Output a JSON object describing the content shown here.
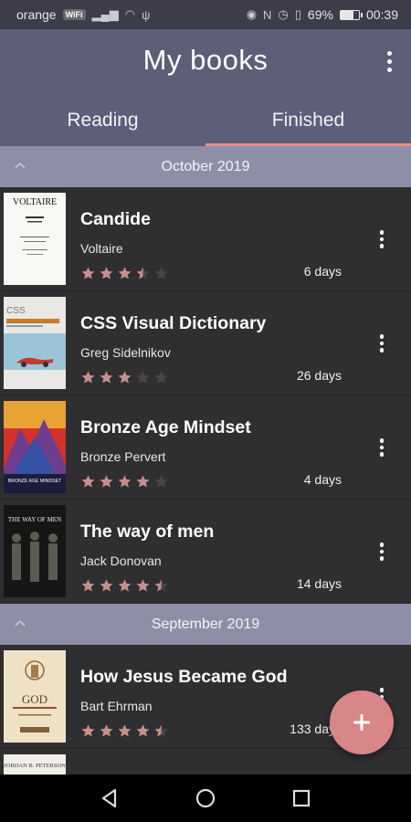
{
  "status_bar": {
    "carrier": "orange",
    "carrier_badge": "WiFi",
    "battery": "69%",
    "battery_level": 0.69,
    "time": "00:39"
  },
  "header": {
    "title": "My books",
    "menu_icon": "more-vert-icon",
    "tabs": [
      {
        "label": "Reading",
        "active": false
      },
      {
        "label": "Finished",
        "active": true
      }
    ]
  },
  "sections": [
    {
      "title": "October 2019",
      "books": [
        {
          "title": "Candide",
          "author": "Voltaire",
          "rating": 3.5,
          "days": "6 days",
          "cover": "voltaire"
        },
        {
          "title": "CSS Visual Dictionary",
          "author": "Greg Sidelnikov",
          "rating": 3,
          "days": "26 days",
          "cover": "css"
        },
        {
          "title": "Bronze Age Mindset",
          "author": "Bronze Pervert",
          "rating": 4,
          "days": "4 days",
          "cover": "bronze"
        },
        {
          "title": "The way of men",
          "author": "Jack Donovan",
          "rating": 4.5,
          "days": "14 days",
          "cover": "wayofmen"
        }
      ]
    },
    {
      "title": "September 2019",
      "books": [
        {
          "title": "How Jesus Became God",
          "author": "Bart Ehrman",
          "rating": 4.5,
          "days": "133 days",
          "cover": "jesus"
        },
        {
          "title": "",
          "author": "",
          "rating": 0,
          "days": "",
          "cover": "peterson"
        }
      ]
    }
  ],
  "covers": {
    "voltaire": "VOLTAIRE",
    "css": "CSS",
    "bronze": "BRONZE AGE MINDSET",
    "wayofmen": "THE WAY OF MEN",
    "jesus": "GOD",
    "peterson": "JORDAN B. PETERSON"
  },
  "colors": {
    "appbar": "#5d5e77",
    "section_header": "#8e8ea6",
    "list_bg": "#2f2f31",
    "accent": "#e8908e",
    "star_filled": "#c98d8d",
    "star_empty": "#4b4548",
    "fab": "#d98688"
  },
  "fab": {
    "icon": "plus-icon"
  },
  "nav": {
    "back_icon": "back-triangle-icon",
    "home_icon": "home-circle-icon",
    "recents_icon": "recents-square-icon"
  }
}
